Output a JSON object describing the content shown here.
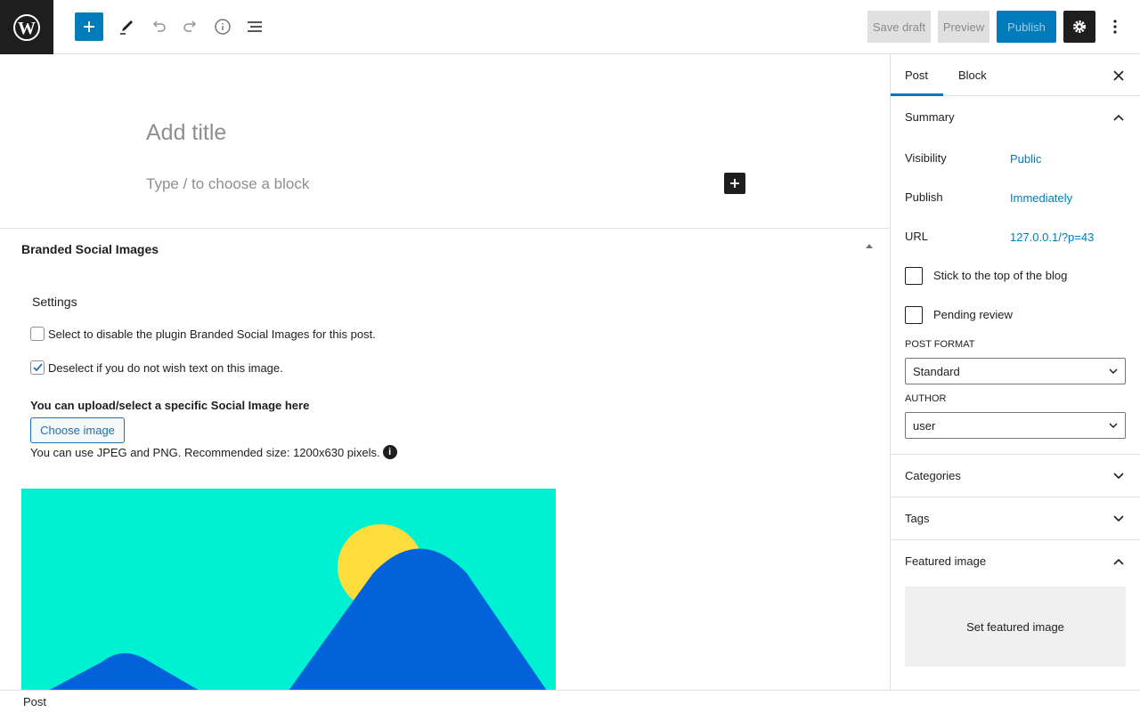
{
  "toolbar": {
    "save_draft": "Save draft",
    "preview": "Preview",
    "publish": "Publish",
    "icons": [
      "wordpress-logo",
      "add-block-icon",
      "tools-pen-icon",
      "undo-icon",
      "redo-icon",
      "info-icon",
      "list-view-icon",
      "settings-gear-icon",
      "more-options-icon"
    ]
  },
  "editor": {
    "title_placeholder": "Add title",
    "block_placeholder": "Type / to choose a block"
  },
  "metabox": {
    "title": "Branded Social Images",
    "settings_label": "Settings",
    "disable_label": "Select to disable the plugin Branded Social Images for this post.",
    "disable_checked": false,
    "text_label": "Deselect if you do not wish text on this image.",
    "text_checked": true,
    "upload_label": "You can upload/select a specific Social Image here",
    "choose_button": "Choose image",
    "hint": "You can use JPEG and PNG. Recommended size: 1200x630 pixels.",
    "image_colors": {
      "background": "#00f0d2",
      "sun": "#fcdd3b",
      "mountain": "#0361da"
    }
  },
  "sidebar": {
    "tabs": [
      {
        "label": "Post",
        "active": true
      },
      {
        "label": "Block",
        "active": false
      }
    ],
    "summary": {
      "title": "Summary",
      "rows": [
        {
          "label": "Visibility",
          "value": "Public"
        },
        {
          "label": "Publish",
          "value": "Immediately"
        },
        {
          "label": "URL",
          "value": "127.0.0.1/?p=43"
        }
      ],
      "sticky_label": "Stick to the top of the blog",
      "sticky_checked": false,
      "pending_label": "Pending review",
      "pending_checked": false,
      "post_format_label": "POST FORMAT",
      "post_format_value": "Standard",
      "author_label": "AUTHOR",
      "author_value": "user"
    },
    "panels": {
      "categories": "Categories",
      "tags": "Tags",
      "featured": "Featured image"
    },
    "featured_button": "Set featured image"
  },
  "footer": {
    "breadcrumb": "Post"
  },
  "colors": {
    "accent": "#007cba",
    "dark": "#1e1e1e"
  }
}
